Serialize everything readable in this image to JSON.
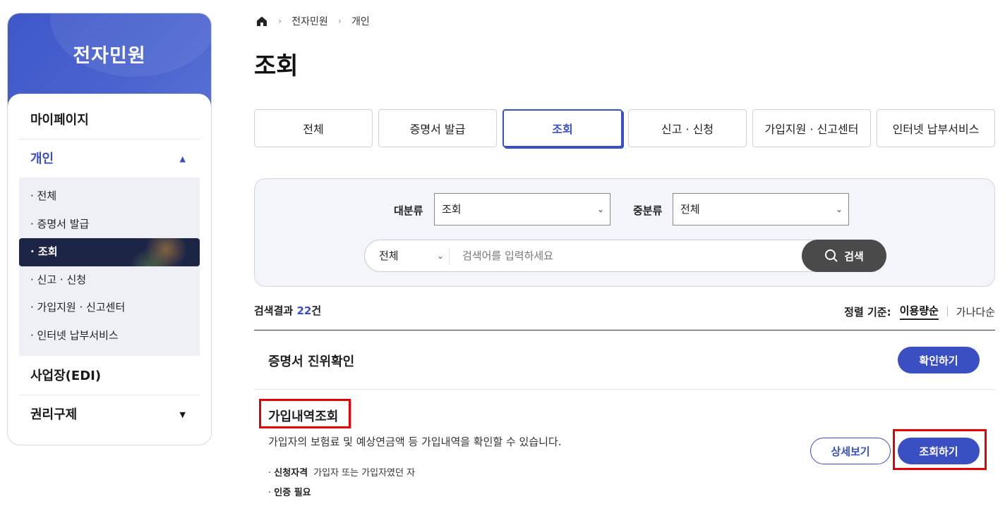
{
  "sidebar": {
    "title": "전자민원",
    "menu": [
      {
        "label": "마이페이지"
      },
      {
        "label": "개인"
      },
      {
        "label": "사업장(EDI)"
      },
      {
        "label": "권리구제"
      }
    ],
    "sub_items": [
      {
        "label": "· 전체"
      },
      {
        "label": "· 증명서 발급"
      },
      {
        "label": "· 조회"
      },
      {
        "label": "· 신고 · 신청"
      },
      {
        "label": "· 가입지원 · 신고센터"
      },
      {
        "label": "· 인터넷 납부서비스"
      }
    ],
    "active_menu": "개인",
    "active_sub": "조회"
  },
  "breadcrumb": [
    "전자민원",
    "개인"
  ],
  "page_title": "조회",
  "tabs": [
    {
      "label": "전체"
    },
    {
      "label": "증명서 발급"
    },
    {
      "label": "조회"
    },
    {
      "label": "신고 · 신청"
    },
    {
      "label": "가입지원 · 신고센터"
    },
    {
      "label": "인터넷 납부서비스"
    }
  ],
  "active_tab": "조회",
  "filters": {
    "major_label": "대분류",
    "major_value": "조회",
    "middle_label": "중분류",
    "middle_value": "전체"
  },
  "search": {
    "scope": "전체",
    "placeholder": "검색어를 입력하세요",
    "button_label": "검색"
  },
  "results": {
    "prefix": "검색결과",
    "count": "22",
    "suffix": "건"
  },
  "sort": {
    "label": "정렬 기준:",
    "active": "이용량순",
    "other": "가나다순"
  },
  "items": [
    {
      "title": "증명서 진위확인",
      "confirm_button": "확인하기"
    },
    {
      "title": "가입내역조회",
      "description": "가입자의 보험료 및 예상연금액 등 가입내역을 확인할 수 있습니다.",
      "eligibility_label": "신청자격",
      "eligibility_value": "가입자 또는 가입자였던 자",
      "auth_label": "인증 필요",
      "detail_button": "상세보기",
      "query_button": "조회하기"
    }
  ],
  "colors": {
    "accent": "#3a50c2",
    "sidebar_active_bg": "#1d2547",
    "highlight": "#e40000"
  }
}
